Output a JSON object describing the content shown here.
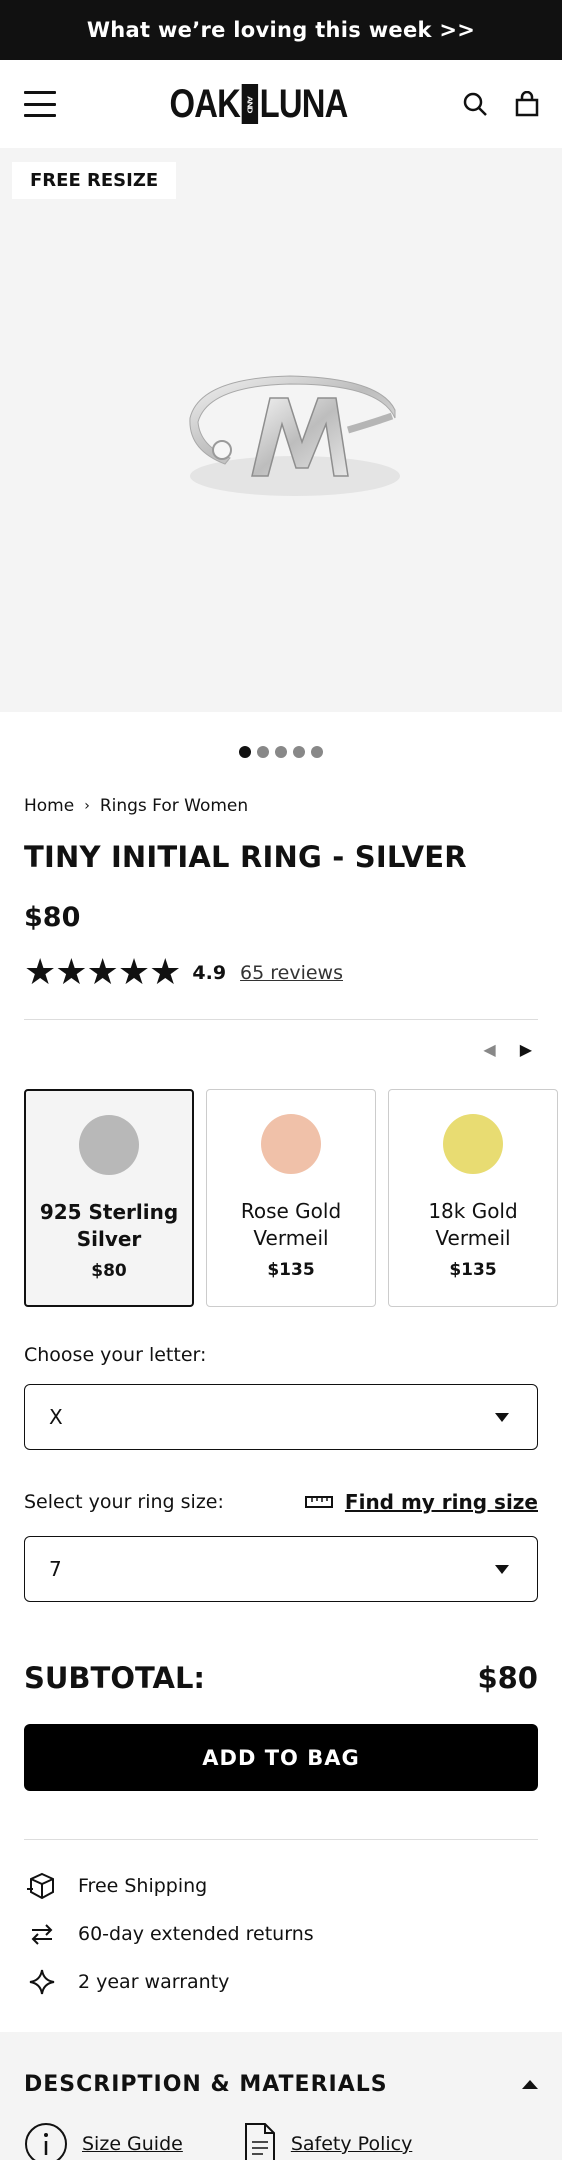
{
  "announcement": "What we’re loving this week >>",
  "brand": {
    "left": "OAK",
    "middle": "AND",
    "right": "LUNA"
  },
  "gallery": {
    "badge": "FREE RESIZE",
    "slides": 5,
    "active_slide": 1
  },
  "breadcrumb": {
    "items": [
      "Home",
      "Rings For Women"
    ],
    "separator": "›"
  },
  "product": {
    "title": "TINY INITIAL RING - SILVER",
    "price": "$80",
    "rating": "4.9",
    "reviews_label": "65 reviews",
    "stars": "★★★★★"
  },
  "carousel": {
    "prev": "◀",
    "next": "▶"
  },
  "variants": [
    {
      "name": "925 Sterling Silver",
      "price": "$80",
      "color": "#b8b8b8",
      "selected": true
    },
    {
      "name": "Rose Gold Vermeil",
      "price": "$135",
      "color": "#f0c1a9",
      "selected": false
    },
    {
      "name": "18k Gold Vermeil",
      "price": "$135",
      "color": "#e8dc72",
      "selected": false
    }
  ],
  "letter": {
    "label": "Choose your letter:",
    "value": "X"
  },
  "ring_size": {
    "label": "Select your ring size:",
    "link": "Find my ring size",
    "value": "7"
  },
  "subtotal": {
    "label": "SUBTOTAL:",
    "value": "$80"
  },
  "add_to_bag": "ADD TO BAG",
  "perks": [
    {
      "icon": "shipping-box-icon",
      "text": "Free Shipping"
    },
    {
      "icon": "returns-arrows-icon",
      "text": "60-day extended returns"
    },
    {
      "icon": "sparkle-icon",
      "text": "2 year warranty"
    }
  ],
  "description": {
    "title": "DESCRIPTION & MATERIALS",
    "links": [
      {
        "icon": "info-icon",
        "text": "Size Guide"
      },
      {
        "icon": "document-icon",
        "text": "Safety Policy"
      }
    ]
  }
}
